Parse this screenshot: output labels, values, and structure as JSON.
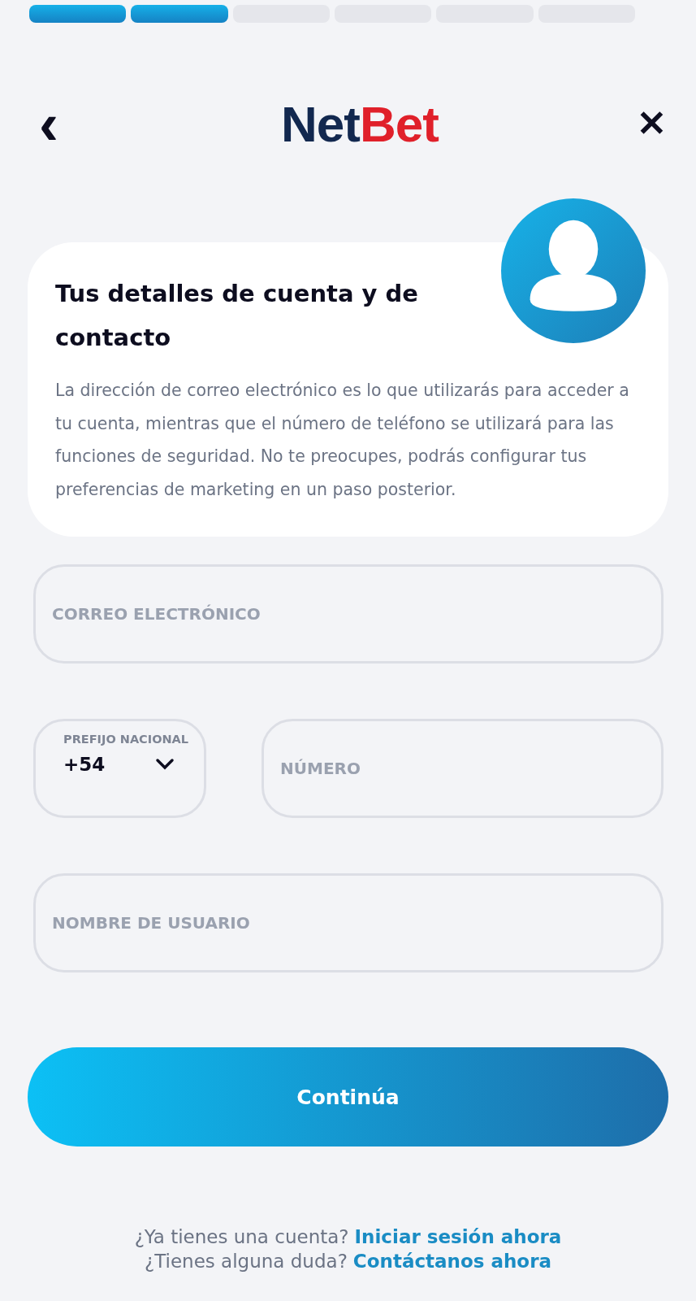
{
  "progress": [
    {
      "filled": true
    },
    {
      "filled": true
    },
    {
      "filled": false
    },
    {
      "filled": false
    },
    {
      "filled": false
    },
    {
      "filled": false
    }
  ],
  "header": {
    "back": "‹",
    "logo": [
      "Net",
      "Bet"
    ],
    "close": "✕"
  },
  "card": {
    "title": "Tus detalles de cuenta y de contacto",
    "text": "La dirección de correo electrónico es lo que utilizarás para acceder a tu cuenta, mientras que el número de teléfono se utilizará para las funciones de seguridad. No te preocupes, podrás configurar tus preferencias de marketing en un paso posterior."
  },
  "email": {
    "placeholder": "CORREO ELECTRÓNICO"
  },
  "prefix": {
    "label": "PREFIJO NACIONAL",
    "value": "+54"
  },
  "phone": {
    "placeholder": "NÚMERO"
  },
  "username": {
    "placeholder": "NOMBRE DE USUARIO"
  },
  "continue_button": "Continúa",
  "footer": [
    {
      "text": "¿Ya tienes una cuenta?",
      "link": "Iniciar sesión ahora"
    },
    {
      "text": "¿Tienes alguna duda?",
      "link": "Contáctanos ahora"
    }
  ]
}
